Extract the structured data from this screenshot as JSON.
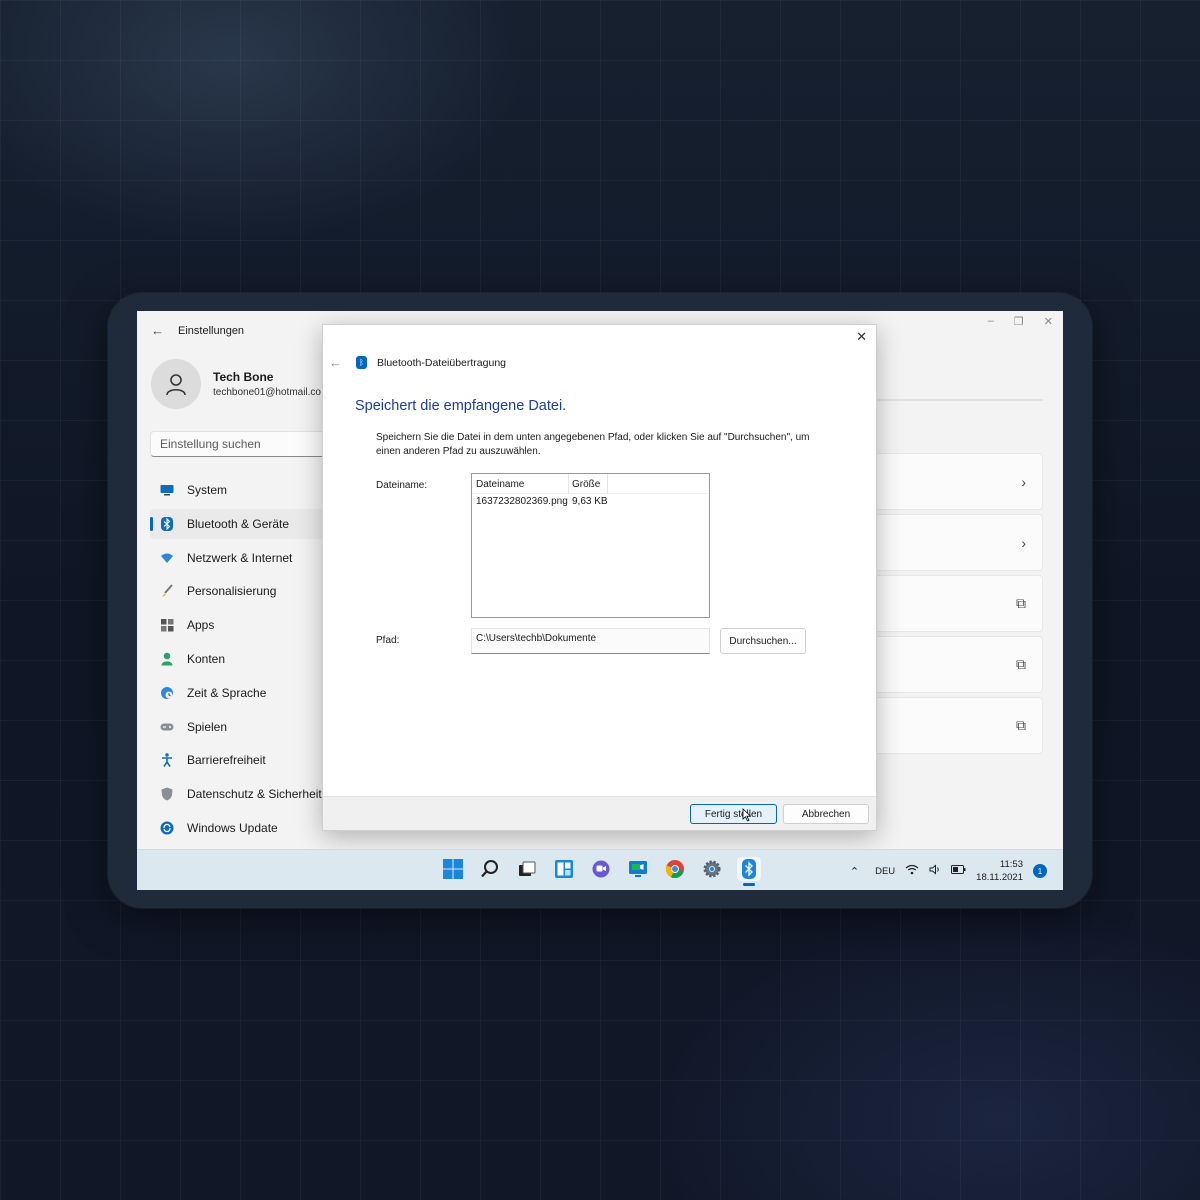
{
  "settings": {
    "window_title": "Einstellungen",
    "profile": {
      "name": "Tech Bone",
      "email": "techbone01@hotmail.co"
    },
    "search_placeholder": "Einstellung suchen",
    "nav": [
      {
        "label": "System",
        "icon": "monitor-icon",
        "active": false
      },
      {
        "label": "Bluetooth & Geräte",
        "icon": "bluetooth-icon",
        "active": true
      },
      {
        "label": "Netzwerk & Internet",
        "icon": "wifi-icon",
        "active": false
      },
      {
        "label": "Personalisierung",
        "icon": "brush-icon",
        "active": false
      },
      {
        "label": "Apps",
        "icon": "apps-icon",
        "active": false
      },
      {
        "label": "Konten",
        "icon": "person-icon",
        "active": false
      },
      {
        "label": "Zeit & Sprache",
        "icon": "globe-clock-icon",
        "active": false
      },
      {
        "label": "Spielen",
        "icon": "gamepad-icon",
        "active": false
      },
      {
        "label": "Barrierefreiheit",
        "icon": "accessibility-icon",
        "active": false
      },
      {
        "label": "Datenschutz & Sicherheit",
        "icon": "shield-icon",
        "active": false
      },
      {
        "label": "Windows Update",
        "icon": "update-icon",
        "active": false
      }
    ],
    "cards": [
      {
        "icon": "chevron-right-icon",
        "glyph": "›"
      },
      {
        "icon": "chevron-right-icon",
        "glyph": "›"
      },
      {
        "icon": "external-link-icon",
        "glyph": "⧉"
      },
      {
        "icon": "external-link-icon",
        "glyph": "⧉"
      },
      {
        "icon": "external-link-icon",
        "glyph": "⧉"
      }
    ]
  },
  "dialog": {
    "header": "Bluetooth-Dateiübertragung",
    "title": "Speichert die empfangene Datei.",
    "instructions": "Speichern Sie die Datei in dem unten angegebenen Pfad, oder klicken Sie auf \"Durchsuchen\", um einen anderen Pfad zu auszuwählen.",
    "file_label": "Dateiname:",
    "columns": [
      "Dateiname",
      "Größe"
    ],
    "files": [
      {
        "name": "1637232802369.png",
        "size": "9,63 KB"
      }
    ],
    "path_label": "Pfad:",
    "path_value": "C:\\Users\\techb\\Dokumente",
    "browse_label": "Durchsuchen...",
    "finish_label": "Fertig stellen",
    "cancel_label": "Abbrechen"
  },
  "taskbar": {
    "apps": [
      "start-icon",
      "search-icon",
      "task-view-icon",
      "widgets-icon",
      "teams-chat-icon",
      "meet-icon",
      "chrome-icon",
      "settings-gear-icon",
      "bluetooth-transfer-icon"
    ],
    "active_app": "bluetooth-transfer-icon",
    "language": "DEU",
    "time": "11:53",
    "date": "18.11.2021",
    "notification_count": "1"
  },
  "colors": {
    "accent": "#0067c0",
    "dialog_title": "#1f3d9a",
    "background": "#111a2b"
  }
}
